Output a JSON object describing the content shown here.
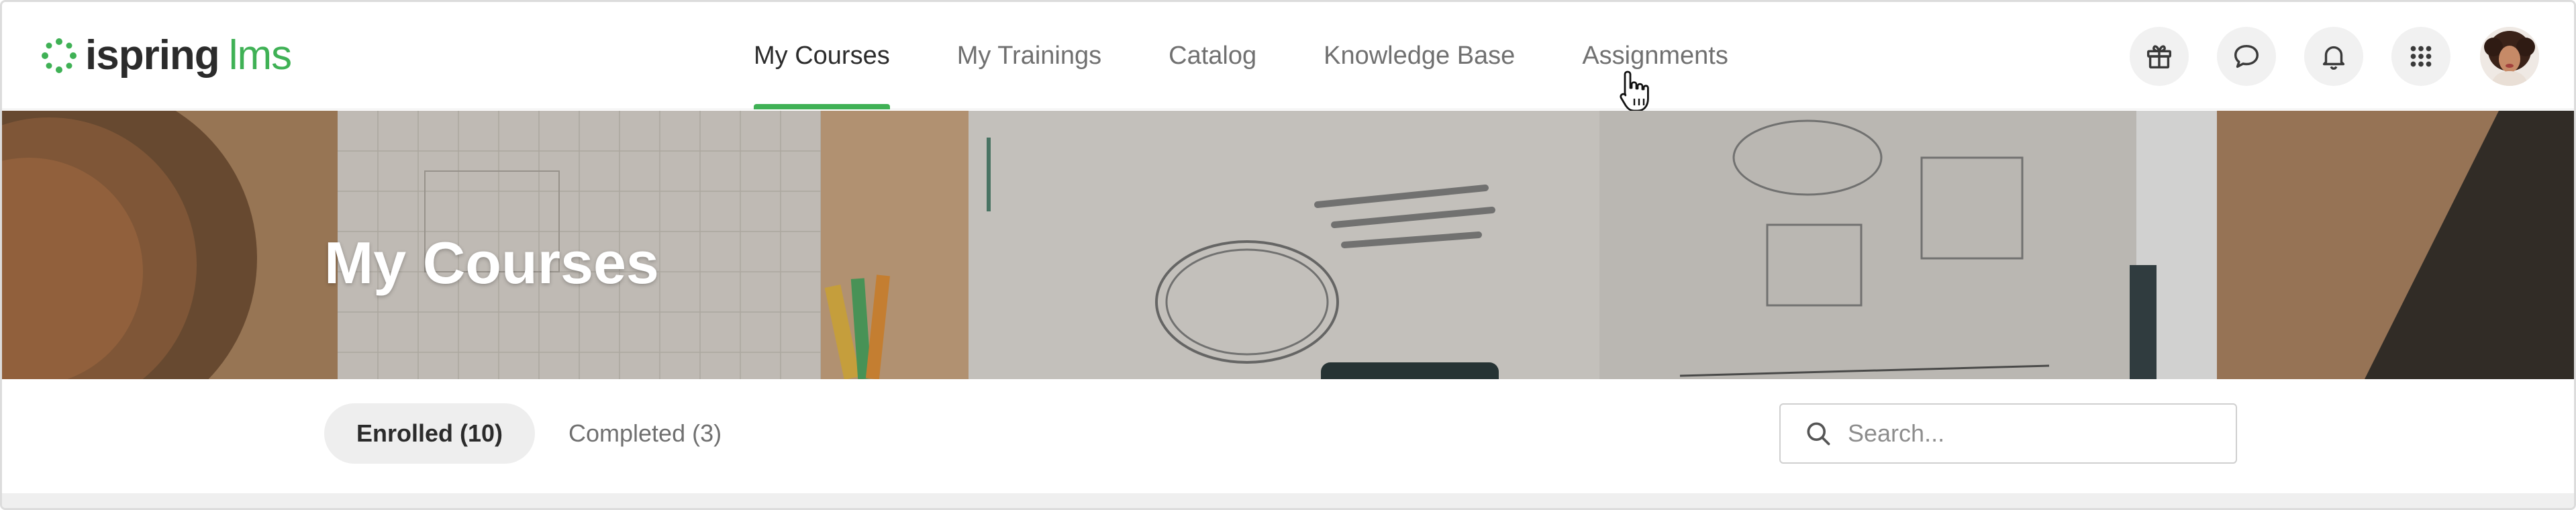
{
  "brand": {
    "name": "ispring",
    "product": "lms",
    "accent": "#3fb155"
  },
  "nav": {
    "items": [
      {
        "label": "My Courses",
        "active": true
      },
      {
        "label": "My Trainings",
        "active": false
      },
      {
        "label": "Catalog",
        "active": false
      },
      {
        "label": "Knowledge Base",
        "active": false
      },
      {
        "label": "Assignments",
        "active": false
      }
    ]
  },
  "header_actions": {
    "icons": [
      "gift-icon",
      "chat-icon",
      "bell-icon",
      "apps-grid-icon"
    ],
    "avatar": "user-avatar"
  },
  "banner": {
    "title": "My Courses"
  },
  "tabs": {
    "enrolled": "Enrolled (10)",
    "completed": "Completed (3)"
  },
  "search": {
    "placeholder": "Search...",
    "value": ""
  }
}
